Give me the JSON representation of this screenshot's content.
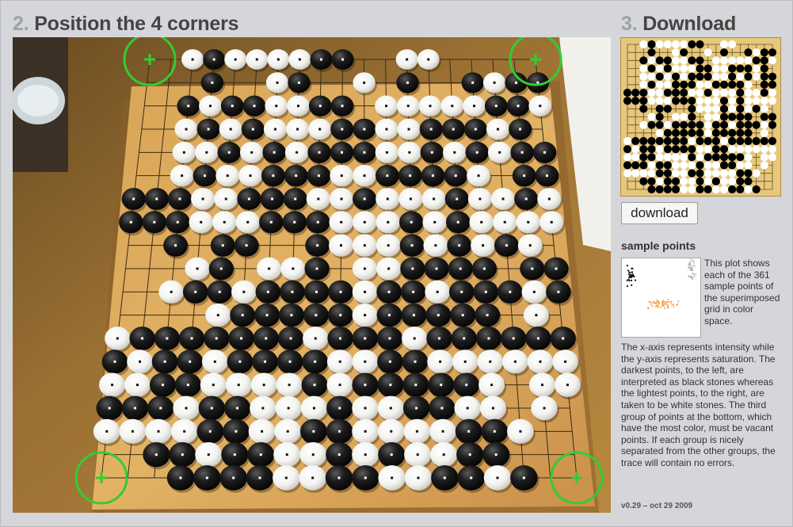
{
  "steps": {
    "position": {
      "number": "2.",
      "title": "Position the 4 corners"
    },
    "download": {
      "number": "3.",
      "title": "Download"
    }
  },
  "photo": {
    "description_icon": "go-board-photo",
    "corner_marker_icon": "crosshair-handle-icon",
    "marker_color": "#33cc33"
  },
  "preview": {
    "board_color": "#e6c77c",
    "rows": [
      "..OXOOOOXX..OO.....",
      "...X..OX..O.X..XOXX",
      "..XOXXOOXX.OOOOOXXO",
      "..OXOXOOOXXOOXXXOX.",
      "..OOXOXOXXXOOXOXOXX",
      "..OXOOXXXOOXXXXO.XX",
      "XXXOOXXXOOXOOOXOOXO",
      "XXXOOOXXXOOOXOXOOOO",
      "..X.XX..XOOOXOXOXO.",
      "...OX.OOX.OOXXXX.XX",
      "..OXXOXXXXOXXOXXXOX",
      "....OXXXXXOXXXXX.O.",
      "OXXXXXXXOXXXOXXXXXX",
      "XOXXOXXXXOOXXOOOOOO",
      "OOXXOOOOXOXXXXXO.OO",
      "XXXOXXOOOXOOXXOO.O.",
      "OOOOXXOOXXOOOOXXO..",
      "..XXOXXOOXOXOOXX...",
      "...XXXXOOXXOOXXOX.."
    ]
  },
  "download_button": {
    "label": "download"
  },
  "sample_points": {
    "heading": "sample points",
    "description_intro": "This plot shows each of the 361 sample points of the superimposed grid in color space.",
    "description_body": "The x-axis represents intensity while the y-axis represents saturation. The darkest points, to the left, are interpreted as black stones whereas the lightest points, to the right, are taken to be white stones. The third group of points at the bottom, which have the most color, must be vacant points. If each group is nicely separated from the other groups, the trace will contain no errors.",
    "x_axis": "intensity",
    "y_axis": "saturation",
    "groups": [
      {
        "name": "black stones",
        "color": "#111111"
      },
      {
        "name": "white stones",
        "color": "#aaaaaa"
      },
      {
        "name": "vacant points",
        "color": "#f4a24a"
      }
    ]
  },
  "version": "v0.29 – oct 29 2009"
}
